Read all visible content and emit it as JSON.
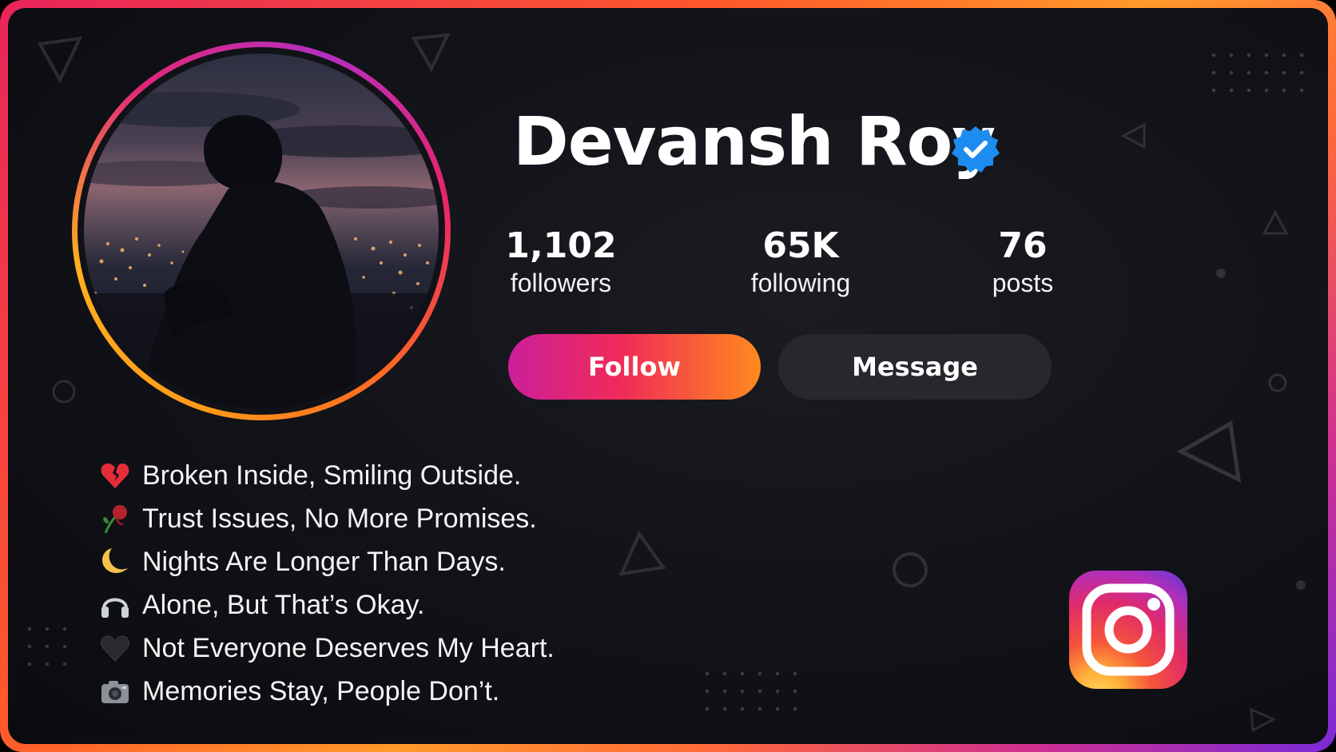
{
  "profile": {
    "name": "Devansh Roy",
    "verified": true
  },
  "stats": [
    {
      "value": "1,102",
      "label": "followers"
    },
    {
      "value": "65K",
      "label": "following"
    },
    {
      "value": "76",
      "label": "posts"
    }
  ],
  "actions": {
    "follow_label": "Follow",
    "message_label": "Message"
  },
  "bio": [
    {
      "icon": "broken-heart-icon",
      "text": "Broken Inside, Smiling Outside."
    },
    {
      "icon": "wilted-rose-icon",
      "text": "Trust Issues, No More Promises."
    },
    {
      "icon": "crescent-moon-icon",
      "text": "Nights Are Longer Than Days."
    },
    {
      "icon": "headphones-icon",
      "text": "Alone, But That’s Okay."
    },
    {
      "icon": "black-heart-icon",
      "text": "Not Everyone Deserves My Heart."
    },
    {
      "icon": "camera-icon",
      "text": "Memories Stay, People Don’t."
    }
  ],
  "brand": {
    "logo": "instagram-logo-icon",
    "follow_gradient": [
      "#cc1f9a",
      "#f02b58",
      "#ff8a1e"
    ],
    "verified_color": "#1d8cf0",
    "background": "#111217"
  }
}
